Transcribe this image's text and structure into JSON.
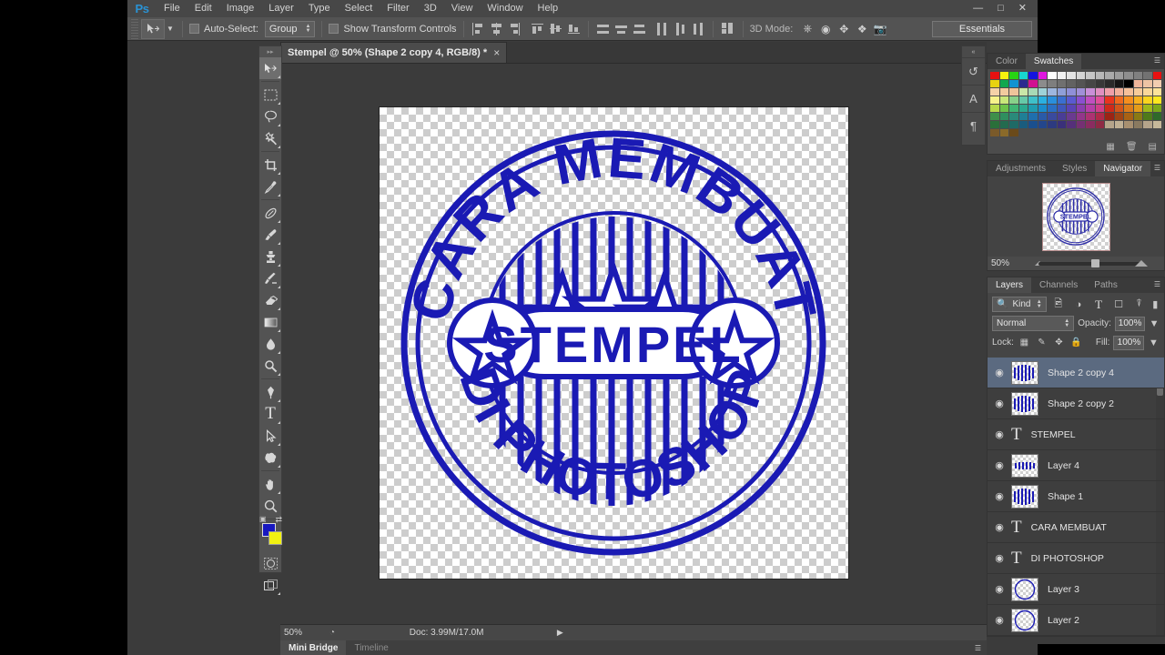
{
  "app": {
    "name": "Adobe Photoshop",
    "logo_text": "Ps",
    "workspace": "Essentials"
  },
  "menubar": {
    "items": [
      "File",
      "Edit",
      "Image",
      "Layer",
      "Type",
      "Select",
      "Filter",
      "3D",
      "View",
      "Window",
      "Help"
    ]
  },
  "options_bar": {
    "tool_icon": "move-tool-icon",
    "auto_select_label": "Auto-Select:",
    "auto_select_checked": false,
    "auto_select_value": "Group",
    "show_transform_label": "Show Transform Controls",
    "show_transform_checked": false,
    "mode3d_label": "3D Mode:",
    "mode3d_icons": [
      "orbit-3d-icon",
      "roll-3d-icon",
      "pan-3d-icon",
      "slide-3d-icon",
      "camera-3d-icon"
    ],
    "align_icons": [
      "align-left-edges-icon",
      "align-horizontal-centers-icon",
      "align-right-edges-icon",
      "align-top-edges-icon",
      "align-vertical-centers-icon",
      "align-bottom-edges-icon"
    ],
    "distribute_icons": [
      "distribute-top-edges-icon",
      "distribute-vertical-centers-icon",
      "distribute-bottom-edges-icon",
      "distribute-left-edges-icon",
      "distribute-horizontal-centers-icon",
      "distribute-right-edges-icon"
    ],
    "auto_align_icon": "auto-align-layers-icon"
  },
  "document": {
    "tab_title": "Stempel @ 50% (Shape 2 copy 4, RGB/8) *",
    "close_glyph": "×",
    "zoom": "50%",
    "doc_size": "Doc: 3.99M/17.0M",
    "canvas_transparent": true
  },
  "toolbox": {
    "tools": [
      {
        "name": "move-tool",
        "glyph": "➤",
        "selected": true,
        "has_flyout": true
      },
      {
        "name": "rectangular-marquee-tool",
        "glyph": "⬚",
        "selected": false,
        "has_flyout": true
      },
      {
        "name": "lasso-tool",
        "glyph": "⟃",
        "selected": false,
        "has_flyout": true
      },
      {
        "name": "magic-wand-tool",
        "glyph": "✳",
        "selected": false,
        "has_flyout": true
      },
      {
        "name": "crop-tool",
        "glyph": "⌗",
        "selected": false,
        "has_flyout": true
      },
      {
        "name": "eyedropper-tool",
        "glyph": "✒",
        "selected": false,
        "has_flyout": true
      },
      {
        "name": "spot-healing-brush-tool",
        "glyph": "⊕",
        "selected": false,
        "has_flyout": true
      },
      {
        "name": "brush-tool",
        "glyph": "✎",
        "selected": false,
        "has_flyout": true
      },
      {
        "name": "clone-stamp-tool",
        "glyph": "⚒",
        "selected": false,
        "has_flyout": true
      },
      {
        "name": "history-brush-tool",
        "glyph": "✐",
        "selected": false,
        "has_flyout": true
      },
      {
        "name": "eraser-tool",
        "glyph": "▱",
        "selected": false,
        "has_flyout": true
      },
      {
        "name": "gradient-tool",
        "glyph": "▭",
        "selected": false,
        "has_flyout": true
      },
      {
        "name": "blur-tool",
        "glyph": "●",
        "selected": false,
        "has_flyout": true
      },
      {
        "name": "dodge-tool",
        "glyph": "⚲",
        "selected": false,
        "has_flyout": true
      },
      {
        "name": "pen-tool",
        "glyph": "✑",
        "selected": false,
        "has_flyout": true
      },
      {
        "name": "horizontal-type-tool",
        "glyph": "T",
        "selected": false,
        "has_flyout": true
      },
      {
        "name": "path-selection-tool",
        "glyph": "↖",
        "selected": false,
        "has_flyout": true
      },
      {
        "name": "rectangle-shape-tool",
        "glyph": "⬟",
        "selected": false,
        "has_flyout": true
      },
      {
        "name": "hand-tool",
        "glyph": "✋",
        "selected": false,
        "has_flyout": true
      },
      {
        "name": "zoom-tool",
        "glyph": "⚲",
        "selected": false,
        "has_flyout": false
      }
    ],
    "foreground_color": "#1818c0",
    "background_color": "#f2f211",
    "swap_glyph": "⇄",
    "quick_mask_glyph": "◯",
    "screen_mode_glyph": "◱"
  },
  "mini_dock": {
    "collapse_glyph": "«",
    "items": [
      {
        "name": "history-panel-icon",
        "glyph": "↺"
      },
      {
        "name": "character-panel-icon",
        "glyph": "A"
      },
      {
        "name": "paragraph-panel-icon",
        "glyph": "¶"
      }
    ]
  },
  "color_panel": {
    "tabs": [
      {
        "label": "Color",
        "active": false
      },
      {
        "label": "Swatches",
        "active": true
      }
    ],
    "menu_glyph": "☰",
    "new_swatch_icon": "new-swatch-icon",
    "delete_swatch_icon": "trash-icon",
    "swatch_rows": [
      [
        "#e81111",
        "#f6f10e",
        "#27d413",
        "#18d7cf",
        "#1414e0",
        "#e018e0",
        "#ffffff",
        "#f0f0f0",
        "#e2e2e2",
        "#d4d4d4",
        "#c6c6c6",
        "#b8b8b8",
        "#aaaaaa",
        "#9c9c9c",
        "#8e8e8e",
        "#808080",
        "#727272",
        "#e81111"
      ],
      [
        "#e8d211",
        "#11a84f",
        "#1193d1",
        "#2a2a8f",
        "#d11191",
        "#8c8c8c",
        "#7e7e7e",
        "#707070",
        "#626262",
        "#545454",
        "#464646",
        "#383838",
        "#2a2a2a",
        "#151515",
        "#000000",
        "#f0b59a",
        "#eec3a4",
        "#f2cdb0"
      ],
      [
        "#f5d1a8",
        "#f2cb9e",
        "#eec49a",
        "#c9e7a8",
        "#a8d9b6",
        "#9fd2d8",
        "#9db6df",
        "#8f9fd8",
        "#8f8fd8",
        "#a08fd8",
        "#c98fd8",
        "#e08fc0",
        "#ef9fa8",
        "#f2b09a",
        "#f5c09a",
        "#f7cb9a",
        "#f9d79a",
        "#fbe29a"
      ],
      [
        "#f7f28a",
        "#c9e77a",
        "#88d18a",
        "#66c9a8",
        "#3fc0c9",
        "#2bb0e0",
        "#2a8fdc",
        "#3a6fd0",
        "#5a5ad0",
        "#8a4fd0",
        "#c04fc0",
        "#e04f9a",
        "#e8341f",
        "#ef6a1f",
        "#f58f1f",
        "#f7b01f",
        "#f9d41f",
        "#fbe81f"
      ],
      [
        "#b7d94a",
        "#6cc24a",
        "#3fb573",
        "#2ba98f",
        "#1f9cb0",
        "#1a8ccc",
        "#2a6fc4",
        "#3f57bb",
        "#5a44b5",
        "#8a3fb0",
        "#b53fa8",
        "#d03f8a",
        "#cf2a1a",
        "#d4561a",
        "#dd7d1a",
        "#e49c1a",
        "#9fb81a",
        "#7ba81a"
      ],
      [
        "#3f8f4a",
        "#2f8f5f",
        "#2a8a7a",
        "#1f7f96",
        "#1f6fae",
        "#2a5aa8",
        "#3a4a9e",
        "#4a3d96",
        "#6a3a90",
        "#93368a",
        "#ad3272",
        "#b02a4a",
        "#9c2414",
        "#a04414",
        "#a86214",
        "#8a7a14",
        "#4f7a1a",
        "#2f6a2a"
      ],
      [
        "#2a6f3a",
        "#236b4f",
        "#1f6a66",
        "#1a5c7e",
        "#1a4f8e",
        "#23468c",
        "#2d3a80",
        "#3a307a",
        "#55307a",
        "#753073",
        "#8a2c60",
        "#8f2a44",
        "#b5a48a",
        "#c0b094",
        "#a89070",
        "#8a7a60",
        "#b5a48a",
        "#c6b89a"
      ],
      [
        "#7a5a2a",
        "#8a6a2a",
        "#6a4a1a",
        "",
        "",
        "",
        "",
        "",
        "",
        "",
        "",
        "",
        "",
        "",
        "",
        "",
        "",
        ""
      ]
    ]
  },
  "navigator_panel": {
    "tabs": [
      {
        "label": "Adjustments",
        "active": false
      },
      {
        "label": "Styles",
        "active": false
      },
      {
        "label": "Navigator",
        "active": true
      }
    ],
    "menu_glyph": "☰",
    "zoom_value": "50%",
    "zoom_out_icon": "zoom-out-icon",
    "zoom_in_icon": "zoom-in-icon"
  },
  "layers_panel": {
    "tabs": [
      {
        "label": "Layers",
        "active": true
      },
      {
        "label": "Channels",
        "active": false
      },
      {
        "label": "Paths",
        "active": false
      }
    ],
    "menu_glyph": "☰",
    "filter_label": "Kind",
    "filter_search_icon": "search-icon",
    "filter_icons": [
      "filter-pixel-icon",
      "filter-adjustment-icon",
      "filter-type-icon",
      "filter-shape-icon",
      "filter-smartobject-icon"
    ],
    "filter_toggle_icon": "filter-toggle-icon",
    "blend_mode": "Normal",
    "opacity_label": "Opacity:",
    "opacity_value": "100%",
    "fill_label": "Fill:",
    "fill_value": "100%",
    "lock_label": "Lock:",
    "lock_icons": [
      "lock-transparent-pixels-icon",
      "lock-image-pixels-icon",
      "lock-position-icon",
      "lock-all-icon"
    ],
    "layers": [
      {
        "name": "Shape 2 copy 4",
        "type": "shape",
        "visible": true,
        "selected": true
      },
      {
        "name": "Shape 2 copy 2",
        "type": "shape",
        "visible": true,
        "selected": false
      },
      {
        "name": "STEMPEL",
        "type": "text",
        "visible": true,
        "selected": false
      },
      {
        "name": "Layer 4",
        "type": "pixel",
        "visible": true,
        "selected": false
      },
      {
        "name": "Shape 1",
        "type": "shape",
        "visible": true,
        "selected": false
      },
      {
        "name": "CARA MEMBUAT",
        "type": "text",
        "visible": true,
        "selected": false
      },
      {
        "name": "DI PHOTOSHOP",
        "type": "text",
        "visible": true,
        "selected": false
      },
      {
        "name": "Layer 3",
        "type": "circle",
        "visible": true,
        "selected": false
      },
      {
        "name": "Layer 2",
        "type": "circle",
        "visible": true,
        "selected": false
      }
    ],
    "eye_glyph": "◉",
    "type_glyph": "T"
  },
  "bottom_tabs": [
    {
      "label": "Mini Bridge",
      "active": true
    },
    {
      "label": "Timeline",
      "active": false
    }
  ],
  "artwork": {
    "description": "blue rubber stamp graphic on transparent background",
    "top_text": "CARA MEMBUAT",
    "center_text": "STEMPEL",
    "bottom_text": "DI PHOTOSHOP",
    "ink_color": "#1a1ab4",
    "star_count_top": 3,
    "side_star_count": 2
  }
}
